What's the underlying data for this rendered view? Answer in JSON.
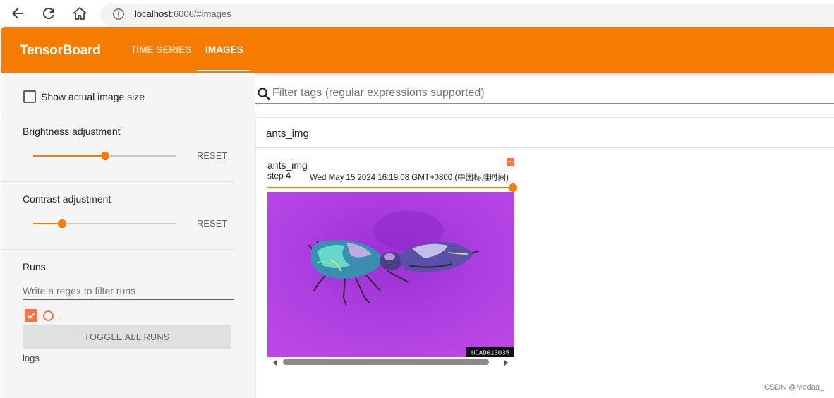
{
  "browser": {
    "url_host": "localhost",
    "url_rest": ":6006/#images"
  },
  "header": {
    "brand": "TensorBoard",
    "tabs": [
      {
        "label": "TIME SERIES",
        "active": false
      },
      {
        "label": "IMAGES",
        "active": true
      }
    ]
  },
  "sidebar": {
    "show_actual_size_label": "Show actual image size",
    "brightness": {
      "label": "Brightness adjustment",
      "reset_label": "RESET",
      "value_fraction": 0.5
    },
    "contrast": {
      "label": "Contrast adjustment",
      "reset_label": "RESET",
      "value_fraction": 0.2
    },
    "runs": {
      "title": "Runs",
      "filter_placeholder": "Write a regex to filter runs",
      "run_name": ".",
      "toggle_label": "TOGGLE ALL RUNS",
      "directory": "logs"
    }
  },
  "main": {
    "filter_placeholder": "Filter tags (regular expressions supported)",
    "group_title": "ants_img",
    "card": {
      "title": "ants_img",
      "step_prefix": "step",
      "step_value": "4",
      "timestamp": "Wed May 15 2024 16:19:08 GMT+0800 (中国标准时间)",
      "image_id_text": "UCAD013035"
    }
  },
  "watermark": "CSDN @Modaa_",
  "colors": {
    "accent": "#f57c00",
    "run_color": "#ff7043",
    "image_bg": "#b13fe0"
  }
}
